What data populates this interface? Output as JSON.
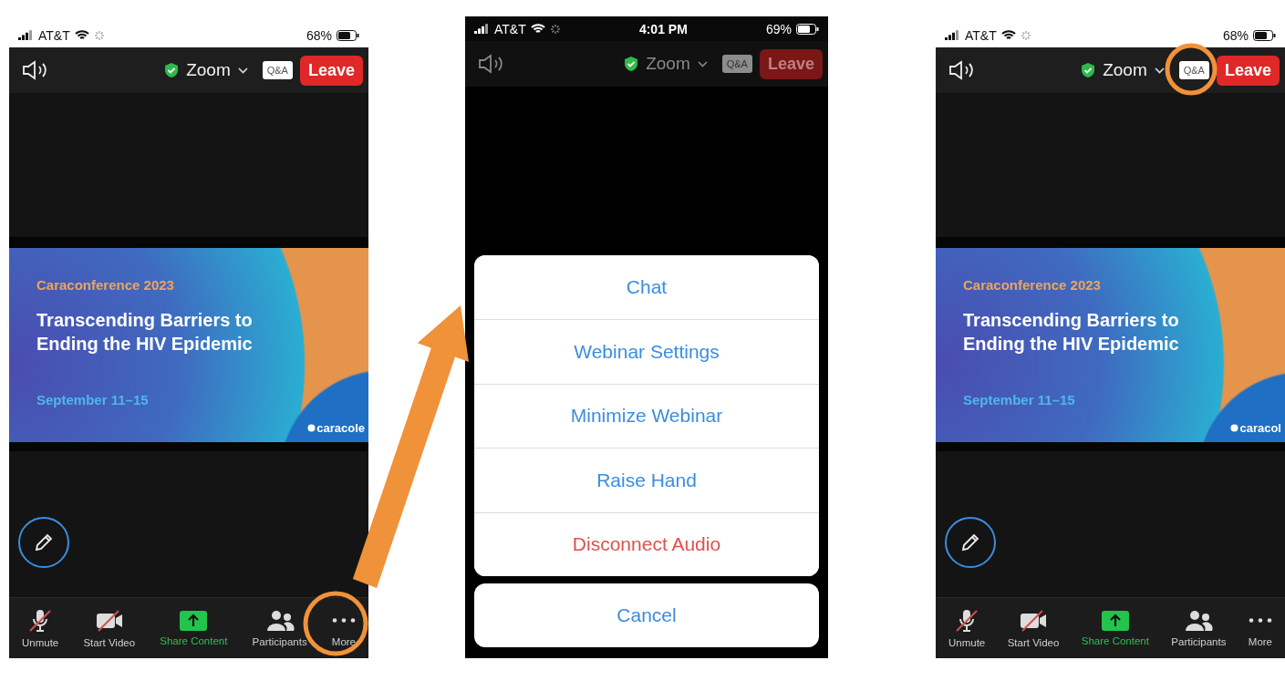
{
  "screens": [
    {
      "status_bar": {
        "carrier": "AT&T",
        "battery": "68%"
      },
      "dimmed": false,
      "top_bar": {
        "meeting": "Zoom",
        "qa": "Q&A",
        "leave": "Leave"
      },
      "slide": {
        "eyebrow": "Caraconference 2023",
        "title": "Transcending Barriers to Ending the HIV Epidemic",
        "dates": "September 11–15",
        "logo": "caracole"
      },
      "toolbar": [
        {
          "kind": "mic",
          "label": "Unmute",
          "muted": true
        },
        {
          "kind": "video",
          "label": "Start Video",
          "muted": true
        },
        {
          "kind": "share",
          "label": "Share Content"
        },
        {
          "kind": "participants",
          "label": "Participants"
        },
        {
          "kind": "more",
          "label": "More"
        }
      ]
    },
    {
      "status_bar": {
        "carrier": "AT&T",
        "time": "4:01 PM",
        "battery": "69%"
      },
      "dimmed": true,
      "top_bar": {
        "meeting": "Zoom",
        "qa": "Q&A",
        "leave": "Leave"
      },
      "action_sheet": {
        "items": [
          {
            "label": "Chat",
            "kind": "default"
          },
          {
            "label": "Webinar Settings",
            "kind": "default"
          },
          {
            "label": "Minimize Webinar",
            "kind": "default"
          },
          {
            "label": "Raise Hand",
            "kind": "default"
          },
          {
            "label": "Disconnect Audio",
            "kind": "destructive"
          }
        ],
        "cancel": "Cancel"
      }
    },
    {
      "status_bar": {
        "carrier": "AT&T",
        "battery": "68%"
      },
      "dimmed": false,
      "top_bar": {
        "meeting": "Zoom",
        "qa": "Q&A",
        "leave": "Leave"
      },
      "slide": {
        "eyebrow": "Caraconference 2023",
        "title": "Transcending Barriers to Ending the HIV Epidemic",
        "dates": "September 11–15",
        "logo": "caracol"
      },
      "toolbar": [
        {
          "kind": "mic",
          "label": "Unmute",
          "muted": true
        },
        {
          "kind": "video",
          "label": "Start Video",
          "muted": true
        },
        {
          "kind": "share",
          "label": "Share Content"
        },
        {
          "kind": "participants",
          "label": "Participants"
        },
        {
          "kind": "more",
          "label": "More"
        }
      ]
    }
  ]
}
